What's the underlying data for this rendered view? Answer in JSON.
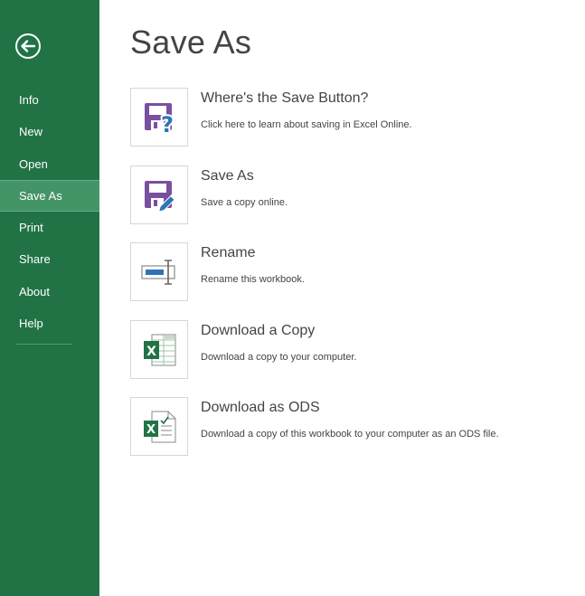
{
  "sidebar": {
    "back_icon": "back-arrow-icon",
    "items": [
      {
        "label": "Info"
      },
      {
        "label": "New"
      },
      {
        "label": "Open"
      },
      {
        "label": "Save As",
        "active": true
      },
      {
        "label": "Print"
      },
      {
        "label": "Share"
      },
      {
        "label": "About"
      },
      {
        "label": "Help"
      }
    ]
  },
  "main": {
    "title": "Save As",
    "options": [
      {
        "icon": "save-help-icon",
        "title": "Where's the Save Button?",
        "description": "Click here to learn about saving in Excel Online."
      },
      {
        "icon": "save-as-icon",
        "title": "Save As",
        "description": "Save a copy online."
      },
      {
        "icon": "rename-icon",
        "title": "Rename",
        "description": "Rename this workbook."
      },
      {
        "icon": "excel-download-icon",
        "title": "Download a Copy",
        "description": "Download a copy to your computer."
      },
      {
        "icon": "ods-download-icon",
        "title": "Download as ODS",
        "description": "Download a copy of this workbook to your computer as an ODS file."
      }
    ]
  },
  "colors": {
    "sidebar": "#217346",
    "sidebar_active": "#439467",
    "icon_purple": "#7b4fa0",
    "icon_blue": "#2e74b5",
    "excel_green": "#217346"
  }
}
